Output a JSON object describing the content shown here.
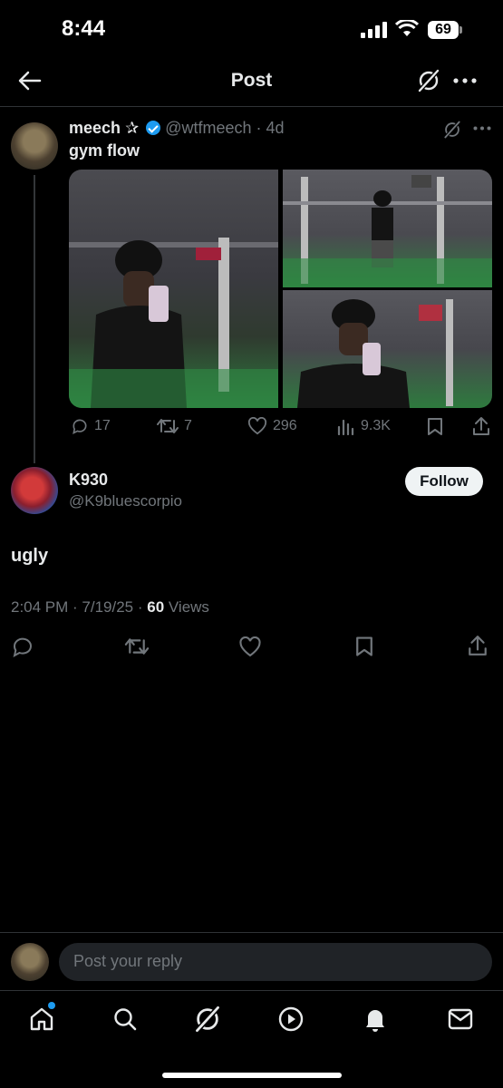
{
  "status_bar": {
    "time": "8:44",
    "battery": "69"
  },
  "header": {
    "title": "Post"
  },
  "tweet": {
    "display_name": "meech",
    "name_badge": "✰",
    "handle": "@wtfmeech",
    "time_ago": "4d",
    "text": "gym flow",
    "stats": {
      "replies": "17",
      "reposts": "7",
      "likes": "296",
      "views": "9.3K"
    }
  },
  "reply": {
    "display_name": "K930",
    "handle": "@K9bluescorpio",
    "follow_label": "Follow",
    "text": "ugly",
    "timestamp": "2:04 PM · 7/19/25 · ",
    "views_count": "60",
    "views_label": " Views"
  },
  "composer": {
    "placeholder": "Post your reply"
  },
  "colors": {
    "accent": "#1d9bf0",
    "background": "#000000",
    "muted": "#71767b"
  }
}
